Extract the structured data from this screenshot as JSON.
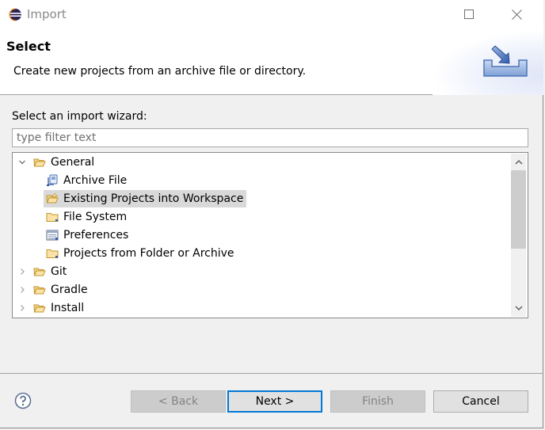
{
  "window": {
    "title": "Import",
    "icons": {
      "app": "eclipse-icon",
      "maximize": "maximize-icon",
      "close": "close-icon"
    }
  },
  "header": {
    "title": "Select",
    "description": "Create new projects from an archive file or directory.",
    "banner_icon": "import-wizard-icon"
  },
  "wizard": {
    "label": "Select an import wizard:",
    "filter": {
      "value": "",
      "placeholder": "type filter text"
    },
    "tree": [
      {
        "label": "General",
        "level": 0,
        "expanded": true,
        "icon": "folder-open-icon"
      },
      {
        "label": "Archive File",
        "level": 1,
        "icon": "archive-file-icon"
      },
      {
        "label": "Existing Projects into Workspace",
        "level": 1,
        "icon": "existing-projects-icon",
        "selected": true
      },
      {
        "label": "File System",
        "level": 1,
        "icon": "folder-icon"
      },
      {
        "label": "Preferences",
        "level": 1,
        "icon": "preferences-icon"
      },
      {
        "label": "Projects from Folder or Archive",
        "level": 1,
        "icon": "folder-icon"
      },
      {
        "label": "Git",
        "level": 0,
        "expanded": false,
        "icon": "folder-open-icon"
      },
      {
        "label": "Gradle",
        "level": 0,
        "expanded": false,
        "icon": "folder-open-icon"
      },
      {
        "label": "Install",
        "level": 0,
        "expanded": false,
        "icon": "folder-open-icon"
      }
    ]
  },
  "footer": {
    "help_icon": "help-icon",
    "back_label": "< Back",
    "next_label": "Next >",
    "finish_label": "Finish",
    "cancel_label": "Cancel"
  },
  "colors": {
    "selection": "#d9d9d9",
    "default_button_border": "#0078d7",
    "disabled_button": "#cccccc"
  }
}
